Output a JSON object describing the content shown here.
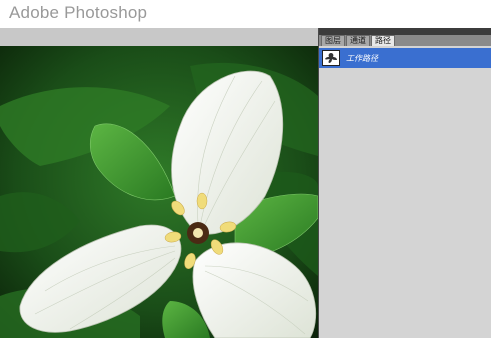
{
  "app": {
    "title": "Adobe Photoshop"
  },
  "panel": {
    "tabs": [
      {
        "label": "图层",
        "active": false
      },
      {
        "label": "通道",
        "active": false
      },
      {
        "label": "路径",
        "active": true
      }
    ],
    "paths": [
      {
        "label": "工作路径",
        "selected": true
      }
    ]
  },
  "image": {
    "subject": "white trillium flower",
    "colors": {
      "background": "#0d2a10",
      "leaf": "#3f9a2e",
      "petal": "#f4f6f0",
      "stamen": "#f0dc7a",
      "selection": "#3a6fd0"
    }
  }
}
